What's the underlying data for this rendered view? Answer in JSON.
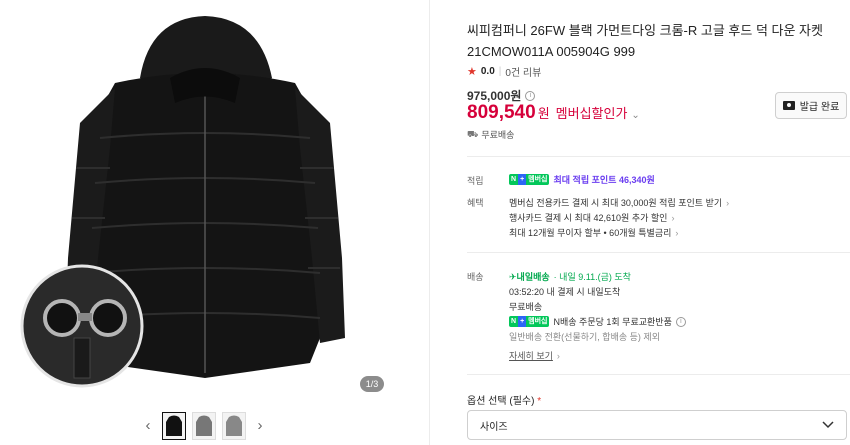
{
  "gallery": {
    "counter": "1/3",
    "thumb_prev": "‹",
    "thumb_next": "›"
  },
  "product": {
    "title": "씨피컴퍼니 26FW 블랙 가먼트다잉 크롬-R 고글 후드 덕 다운 자켓 21CMOW011A 005904G 999",
    "rating_star": "★",
    "rating": "0.0",
    "rating_sep": "|",
    "reviews": "0건 리뷰",
    "original_price": "975,000원",
    "sale_price": "809,540",
    "sale_unit": "원",
    "member_label": "멤버십할인가",
    "coupon_button": "발급 완료",
    "free_shipping": "무료배송"
  },
  "benefits": {
    "accrual_label": "적립",
    "benefit_label": "혜택",
    "badge_n": "N",
    "badge_plus": "+",
    "badge_member": "멤버십",
    "max_points": "최대 적립 포인트 46,340원",
    "lines": [
      "멤버십 전용카드 결제 시 최대 30,000원 적립 포인트 받기",
      "행사카드 결제 시 최대 42,610원 추가 할인",
      "최대 12개월 무이자 할부 • 60개월 특별금리"
    ]
  },
  "shipping": {
    "label": "배송",
    "tomorrow_badge": "✈내일배송",
    "tomorrow_date": "· 내일 9.11.(금) 도착",
    "cutoff": "03:52:20  내 결제 시 내일도착",
    "free": "무료배송",
    "nexchange": "N배송 주문당 1회 무료교환반품",
    "general": "일반배송 전환(선물하기, 합배송 등) 제외",
    "more": "자세히 보기"
  },
  "options": {
    "label": "옵션 선택",
    "required": "(필수)",
    "required_mark": "*",
    "size_placeholder": "사이즈"
  }
}
